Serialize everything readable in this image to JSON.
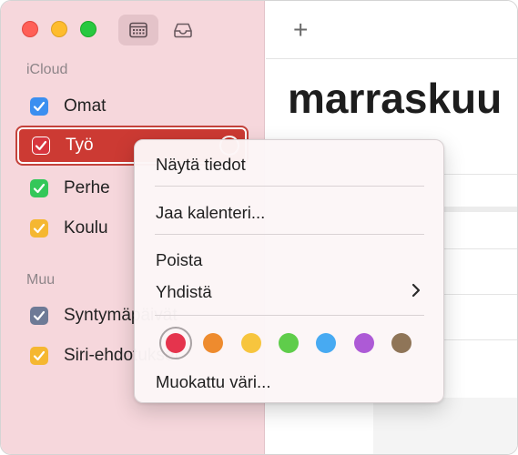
{
  "sidebar": {
    "sections": [
      {
        "label": "iCloud"
      },
      {
        "label": "Muu"
      }
    ],
    "calendars": [
      {
        "label": "Omat",
        "color": "#3b8ff0"
      },
      {
        "label": "Työ",
        "color": "#d8353e"
      },
      {
        "label": "Perhe",
        "color": "#34c759"
      },
      {
        "label": "Koulu",
        "color": "#f5b731"
      },
      {
        "label": "Syntymäpäivät",
        "color": "#6e7a96"
      },
      {
        "label": "Siri-ehdotukset",
        "color": "#f5b731"
      }
    ]
  },
  "toolbar": {
    "calendar_icon": "calendar-icon",
    "inbox_icon": "inbox-icon",
    "add_label": "+"
  },
  "main": {
    "month_title": "marraskuu"
  },
  "context_menu": {
    "items": [
      {
        "label": "Näytä tiedot"
      },
      {
        "label": "Jaa kalenteri..."
      },
      {
        "label": "Poista"
      },
      {
        "label": "Yhdistä"
      },
      {
        "label": "Muokattu väri..."
      }
    ],
    "swatches": [
      "#e5344d",
      "#ee8b2e",
      "#f7c53e",
      "#5fcd4b",
      "#47aaf2",
      "#ad5ad6",
      "#8f7558"
    ],
    "selected_swatch": 0
  }
}
